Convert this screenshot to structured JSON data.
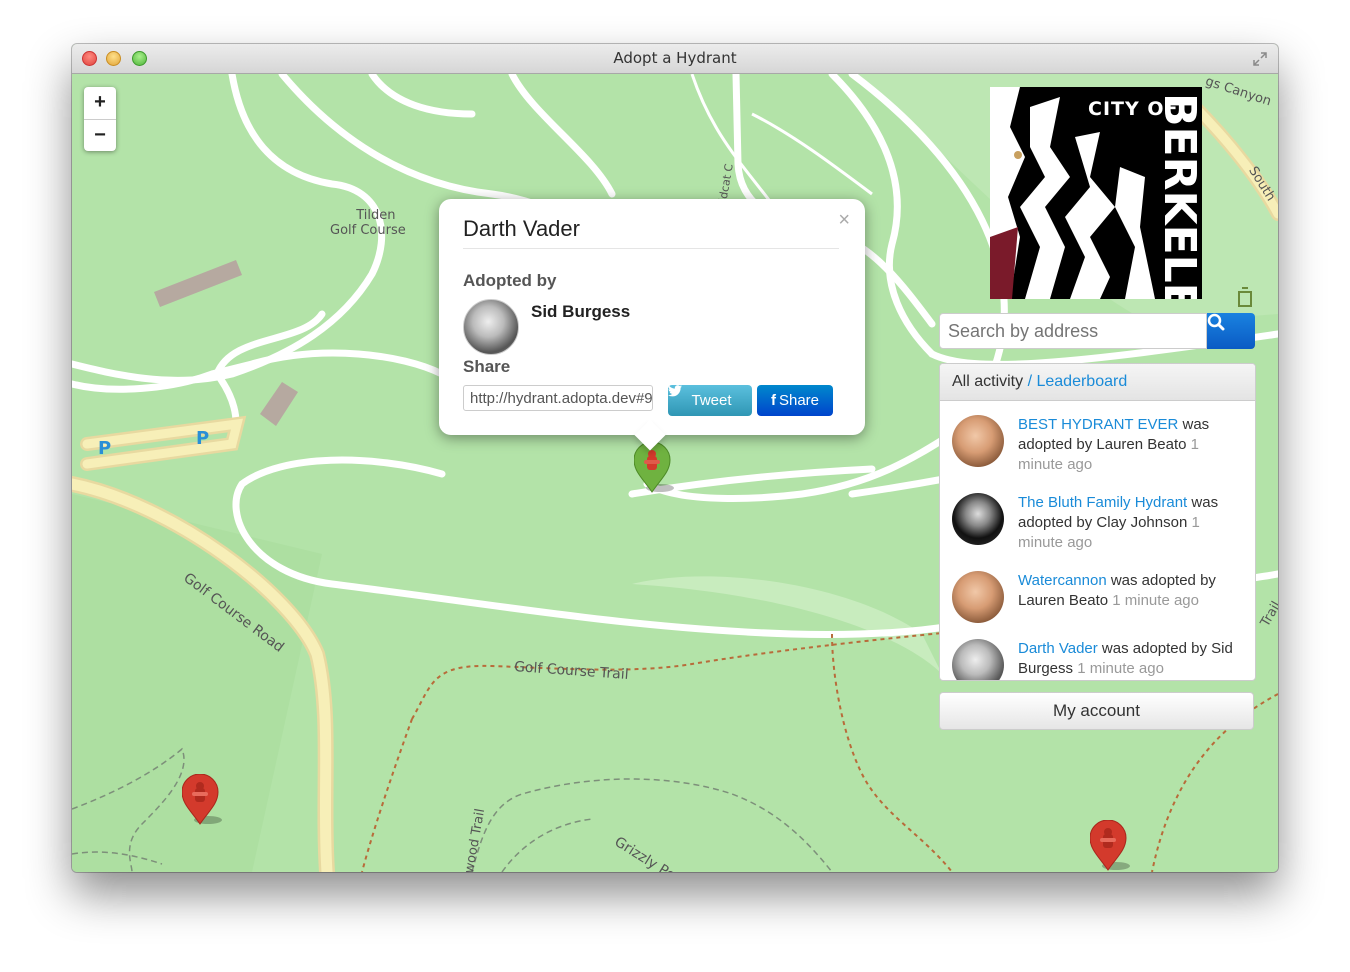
{
  "window": {
    "title": "Adopt a Hydrant"
  },
  "map": {
    "labels": {
      "tilden_golf": [
        "Tilden",
        "Golf Course"
      ],
      "golf_course_road": "Golf Course Road",
      "golf_course_trail": "Golf Course Trail",
      "grizzly_peak_trail": "Grizzly Peak Trail",
      "wildcat": "Wildcat C",
      "redwood_trail": "wood Trail",
      "canyon": "gs Canyon",
      "south": "South",
      "trail_right": "Trail",
      "parking": "P"
    },
    "zoom": {
      "in_label": "+",
      "out_label": "−"
    }
  },
  "popup": {
    "title": "Darth Vader",
    "close_label": "×",
    "adopted_by_label": "Adopted by",
    "adopter_name": "Sid Burgess",
    "share_label": "Share",
    "share_url": "http://hydrant.adopta.dev#9",
    "tweet_label": "Tweet",
    "fb_share_label": "Share"
  },
  "logo": {
    "line1": "CITY OF",
    "line2": "BERKELEY"
  },
  "search": {
    "placeholder": "Search by address"
  },
  "activity": {
    "tab_all": "All activity",
    "separator": "/",
    "tab_leaderboard": "Leaderboard",
    "items": [
      {
        "link": "BEST HYDRANT EVER",
        "rest": " was adopted by Lauren Beato ",
        "time": "1 minute ago"
      },
      {
        "link": "The Bluth Family Hydrant",
        "rest": " was adopted by Clay Johnson ",
        "time": "1 minute ago"
      },
      {
        "link": "Watercannon",
        "rest": " was adopted by Lauren Beato ",
        "time": "1 minute ago"
      },
      {
        "link": "Darth Vader",
        "rest": " was adopted by Sid Burgess ",
        "time": "1 minute ago"
      }
    ]
  },
  "account": {
    "label": "My account"
  },
  "colors": {
    "map_background": "#b3e3a8",
    "marker_adopted": "#6fb240",
    "marker_unadopted": "#d33a2c",
    "link": "#1a8bd8",
    "search_button": "#0a5bc4"
  }
}
